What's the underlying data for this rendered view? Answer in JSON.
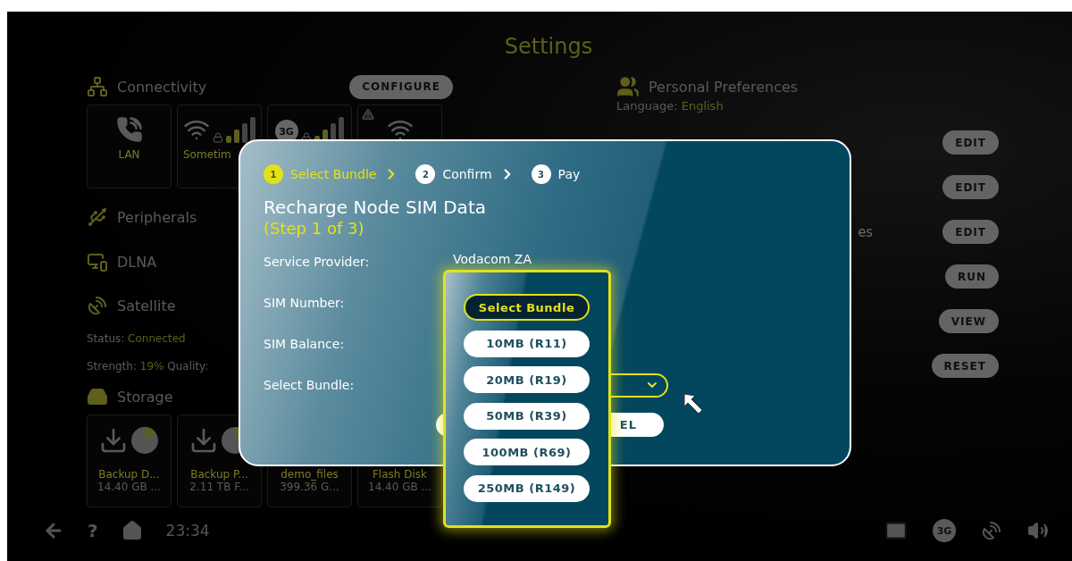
{
  "title": "Settings",
  "connectivity": {
    "heading": "Connectivity",
    "button": "CONFIGURE",
    "tiles": [
      {
        "kind": "lan",
        "label": "LAN"
      },
      {
        "kind": "wifi",
        "label": "Sometim"
      },
      {
        "kind": "cellular",
        "badge": "3G"
      },
      {
        "kind": "warning"
      }
    ]
  },
  "sections": [
    {
      "kind": "peripherals",
      "heading": "Peripherals"
    },
    {
      "kind": "dlna",
      "heading": "DLNA"
    },
    {
      "kind": "satellite",
      "heading": "Satellite"
    }
  ],
  "satellite_status": [
    {
      "label": "Status:",
      "value": "Connected"
    },
    {
      "label": "Strength:",
      "value": "19%",
      "extra": "Quality:"
    }
  ],
  "storage": {
    "heading": "Storage",
    "drives": [
      {
        "name": "Backup D...",
        "detail": "14.40 GB ...",
        "kind": "pie"
      },
      {
        "name": "Backup P...",
        "detail": "2.11 TB F...",
        "kind": "pie"
      },
      {
        "name": "demo_files",
        "detail": "399.36 G...",
        "kind": "covered"
      },
      {
        "name": "Flash Disk",
        "detail": "14.40 GB ...",
        "kind": "covered"
      }
    ]
  },
  "preferences": {
    "heading": "Personal Preferences",
    "language_label": "Language:",
    "language": "English"
  },
  "actions": [
    {
      "label": "EDIT"
    },
    {
      "label": "EDIT"
    },
    {
      "label": "EDIT",
      "caption": "es"
    },
    {
      "label": "RUN"
    },
    {
      "label": "VIEW"
    },
    {
      "label": "RESET"
    }
  ],
  "bottom_bar": {
    "help": "?",
    "time": "23:34",
    "network": "3G"
  },
  "dialog": {
    "steps": [
      {
        "number": "1",
        "label": "Select Bundle",
        "selected": true
      },
      {
        "number": "2",
        "label": "Confirm",
        "selected": false
      },
      {
        "number": "3",
        "label": "Pay",
        "selected": false
      }
    ],
    "heading": "Recharge Node SIM Data",
    "subheading": "(Step 1 of 3)",
    "fields": [
      {
        "label": "Service Provider:",
        "value": "Vodacom ZA"
      },
      {
        "label": "SIM Number:"
      },
      {
        "label": "SIM Balance:"
      },
      {
        "label": "Select Bundle:",
        "kind": "select"
      }
    ],
    "cancel_button": "EL"
  },
  "dropdown": {
    "options": [
      {
        "label": "Select Bundle",
        "selected": true
      },
      {
        "label": "10MB (R11)",
        "selected": false
      },
      {
        "label": "20MB (R19)",
        "selected": false
      },
      {
        "label": "50MB (R39)",
        "selected": false
      },
      {
        "label": "100MB (R69)",
        "selected": false
      },
      {
        "label": "250MB (R149)",
        "selected": false
      }
    ]
  }
}
